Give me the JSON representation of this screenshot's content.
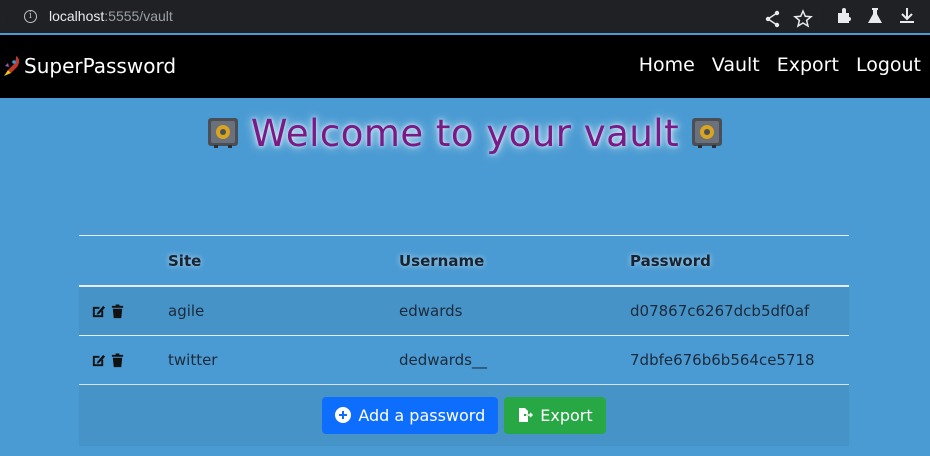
{
  "browser": {
    "url_host": "localhost",
    "url_rest": ":5555/vault"
  },
  "navbar": {
    "brand": "SuperPassword",
    "links": [
      "Home",
      "Vault",
      "Export",
      "Logout"
    ]
  },
  "heading": "Welcome to your vault",
  "table": {
    "headers": [
      "Site",
      "Username",
      "Password"
    ],
    "rows": [
      {
        "site": "agile",
        "username": "edwards",
        "password": "d07867c6267dcb5df0af"
      },
      {
        "site": "twitter",
        "username": "dedwards__",
        "password": "7dbfe676b6b564ce5718"
      }
    ]
  },
  "buttons": {
    "add_password": "Add a password",
    "export": "Export"
  },
  "colors": {
    "page_bg": "#4a9bd3",
    "heading": "#7a1a86",
    "primary": "#0d6efd",
    "success": "#28a745"
  }
}
